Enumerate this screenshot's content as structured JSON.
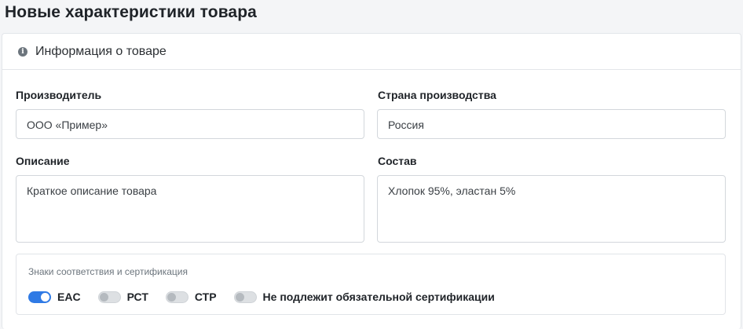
{
  "page": {
    "title": "Новые характеристики товара"
  },
  "card": {
    "header_title": "Информация о товаре",
    "header_icon": "info-icon"
  },
  "fields": {
    "manufacturer": {
      "label": "Производитель",
      "value": "ООО «Пример»"
    },
    "country": {
      "label": "Страна производства",
      "value": "Россия"
    },
    "description": {
      "label": "Описание",
      "value": "Краткое описание товара"
    },
    "composition": {
      "label": "Состав",
      "value": "Хлопок 95%, эластан 5%"
    }
  },
  "certification": {
    "title": "Знаки соответствия и сертификация",
    "toggles": [
      {
        "label": "EAC",
        "checked": true
      },
      {
        "label": "РСТ",
        "checked": false
      },
      {
        "label": "СТР",
        "checked": false
      },
      {
        "label": "Не подлежит обязательной сертификации",
        "checked": false
      }
    ]
  },
  "colors": {
    "accent": "#2f7ae5",
    "toggle_off": "#dde0e3"
  }
}
